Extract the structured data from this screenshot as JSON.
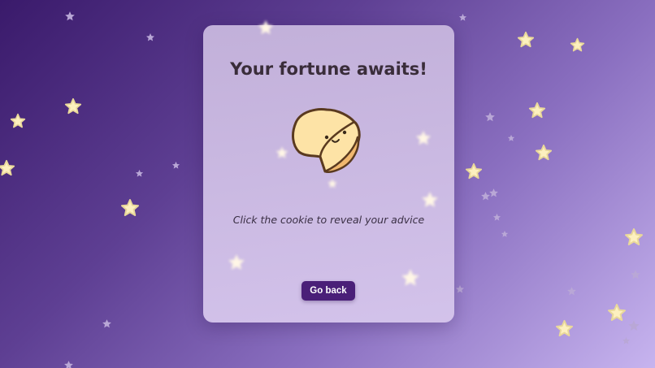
{
  "card": {
    "title": "Your fortune awaits!",
    "hint": "Click the cookie to reveal your advice",
    "back_button_label": "Go back"
  },
  "icons": {
    "cookie": "fortune-cookie-icon",
    "star": "star-icon"
  },
  "colors": {
    "background_start": "#3a1a6b",
    "background_end": "#c7b4ef",
    "card": "#ccbde3",
    "button": "#4a1f78",
    "star": "#fdf0bf"
  }
}
